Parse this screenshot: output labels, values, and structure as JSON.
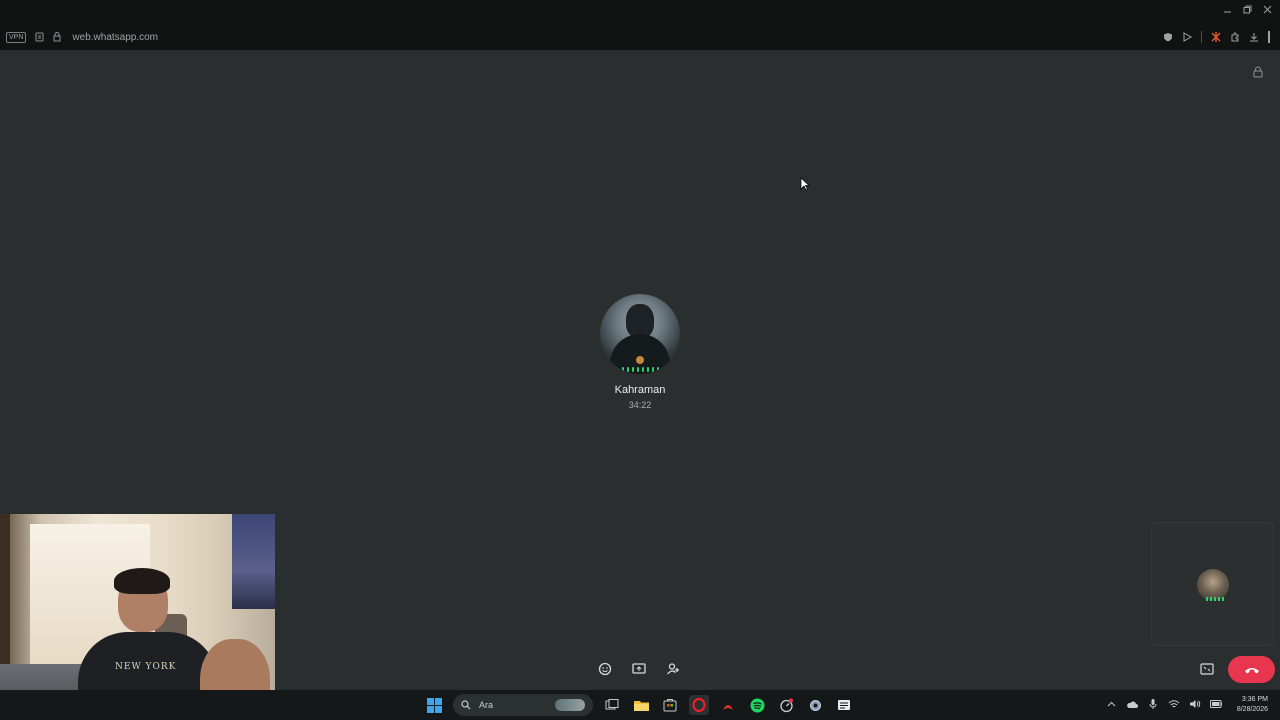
{
  "browser": {
    "vpn_label": "VPN",
    "url": "web.whatsapp.com"
  },
  "call": {
    "contact_name": "Kahraman",
    "duration": "34:22"
  },
  "webcam": {
    "shirt_text": "NEW YORK"
  },
  "taskbar": {
    "search_label": "Ara",
    "clock_time": "3:36 PM",
    "clock_date": "8/28/2026"
  },
  "colors": {
    "end_call": "#e8364f",
    "voice_level": "#2fd06a",
    "background": "#2a2e2e"
  }
}
